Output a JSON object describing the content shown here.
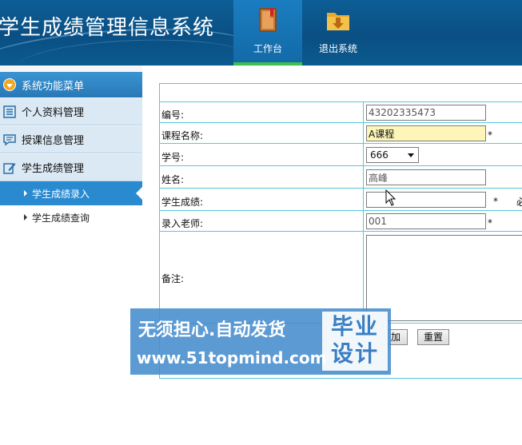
{
  "header": {
    "app_title": "学生成绩管理信息系统",
    "nav": [
      {
        "label": "工作台",
        "icon": "book-icon",
        "active": true
      },
      {
        "label": "退出系统",
        "icon": "folder-download-icon",
        "active": false
      }
    ]
  },
  "sidebar": {
    "menu_title": "系统功能菜单",
    "items": [
      {
        "label": "个人资料管理",
        "icon": "list-icon"
      },
      {
        "label": "授课信息管理",
        "icon": "chat-icon"
      },
      {
        "label": "学生成绩管理",
        "icon": "edit-icon"
      }
    ],
    "sub_items": [
      {
        "label": "学生成绩录入",
        "active": true
      },
      {
        "label": "学生成绩查询",
        "active": false
      }
    ]
  },
  "form": {
    "fields": {
      "id": {
        "label": "编号:",
        "value": "43202335473"
      },
      "course": {
        "label": "课程名称:",
        "value": "A课程",
        "required": "*"
      },
      "student_no": {
        "label": "学号:",
        "value": "666"
      },
      "name": {
        "label": "姓名:",
        "value": "高峰"
      },
      "score": {
        "label": "学生成绩:",
        "value": "",
        "required": "*",
        "hint": "必"
      },
      "teacher": {
        "label": "录入老师:",
        "value": "001",
        "required": "*"
      },
      "remark": {
        "label": "备注:",
        "value": ""
      }
    },
    "buttons": {
      "add": "加",
      "reset": "重置"
    }
  },
  "watermark": {
    "line1": "无须担心.自动发货",
    "line2": "www.51topmind.com",
    "box": "毕业设计"
  },
  "colors": {
    "header_bg": "#0a4f83",
    "active_tab": "#136aa8",
    "active_underline": "#3fc04a",
    "menu_head": "#2a86c6",
    "active_sub": "#2a8ad0",
    "table_border": "#55c8de",
    "highlight_input": "#fdf6b8"
  }
}
